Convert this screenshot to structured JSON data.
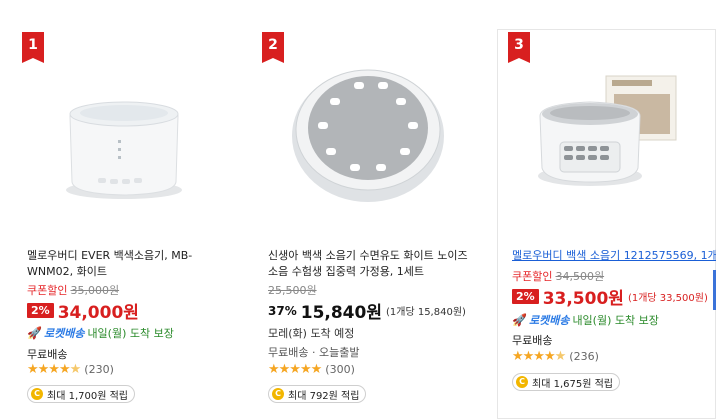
{
  "products": [
    {
      "rank": "1",
      "title": "멜로우버디 EVER 백색소음기, MB-WNM02, 화이트",
      "coupon_label": "쿠폰할인",
      "original_price": "35,000원",
      "discount_badge": "2%",
      "price": "34,000원",
      "rocket_label": "로켓배송",
      "eta": "내일(월) 도착 보장",
      "shipping": "무료배송",
      "review_count": "(230)",
      "reward": "최대 1,700원 적립"
    },
    {
      "rank": "2",
      "title": "신생아 백색 소음기 수면유도 화이트 노이즈 소음 수험생 집중력 가정용, 1세트",
      "original_price": "25,500원",
      "discount_pct": "37%",
      "price": "15,840원",
      "unit_price": "(1개당 15,840원)",
      "delivery": "모레(화) 도착 예정",
      "shipping": "무료배송 · 오늘출발",
      "review_count": "(300)",
      "reward": "최대 792원 적립"
    },
    {
      "rank": "3",
      "title": "멜로우버디 백색 소음기 1212575569, 1개",
      "coupon_label": "쿠폰할인",
      "original_price": "34,500원",
      "discount_badge": "2%",
      "price": "33,500원",
      "unit_price": "(1개당 33,500원)",
      "rocket_label": "로켓배송",
      "eta": "내일(월) 도착 보장",
      "shipping": "무료배송",
      "review_count": "(236)",
      "reward": "최대 1,675원 적립"
    }
  ],
  "colors": {
    "accent_red": "#d81f1f",
    "rocket_blue": "#2c7be5",
    "star": "#f5a623"
  },
  "icons": [
    "rocket-icon",
    "coin-icon",
    "star-icon"
  ]
}
